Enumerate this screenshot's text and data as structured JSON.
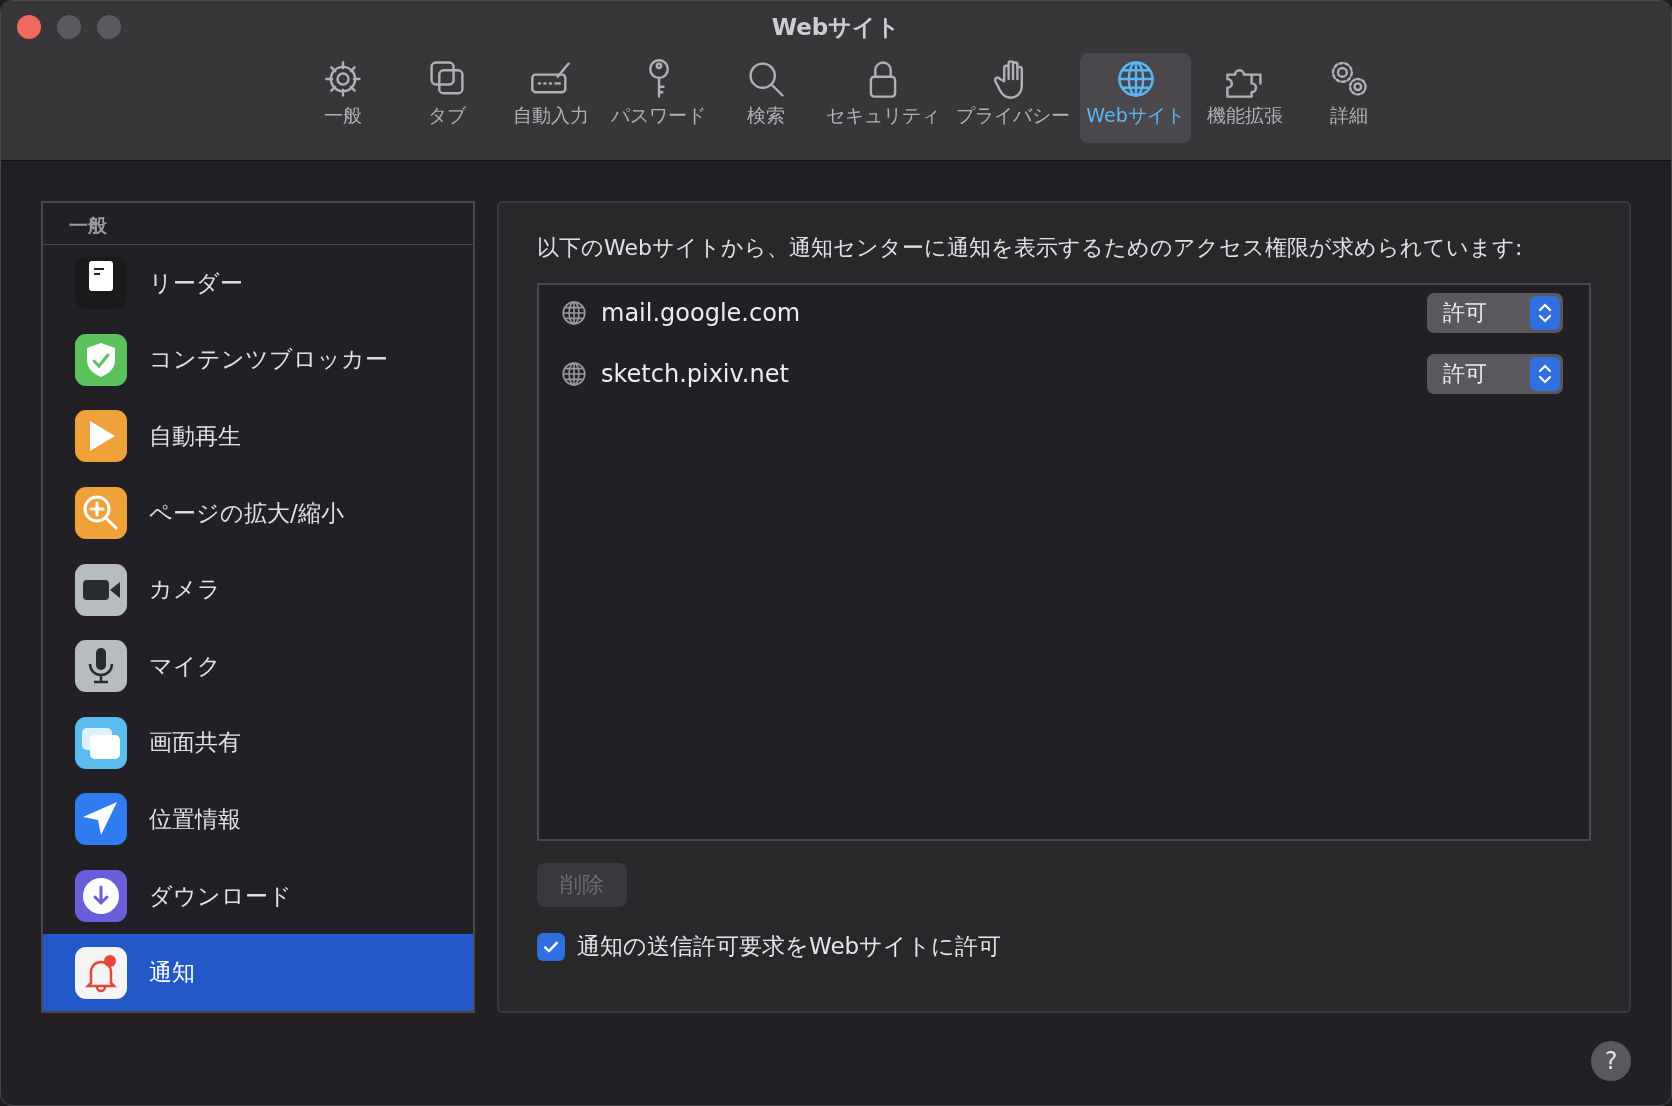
{
  "window": {
    "title": "Webサイト"
  },
  "toolbar": {
    "tabs": [
      {
        "label": "一般",
        "selected": false
      },
      {
        "label": "タブ",
        "selected": false
      },
      {
        "label": "自動入力",
        "selected": false
      },
      {
        "label": "パスワード",
        "selected": false
      },
      {
        "label": "検索",
        "selected": false
      },
      {
        "label": "セキュリティ",
        "selected": false
      },
      {
        "label": "プライバシー",
        "selected": false
      },
      {
        "label": "Webサイト",
        "selected": true
      },
      {
        "label": "機能拡張",
        "selected": false
      },
      {
        "label": "詳細",
        "selected": false
      }
    ]
  },
  "sidebar": {
    "header": "一般",
    "items": [
      {
        "label": "リーダー",
        "selected": false
      },
      {
        "label": "コンテンツブロッカー",
        "selected": false
      },
      {
        "label": "自動再生",
        "selected": false
      },
      {
        "label": "ページの拡大/縮小",
        "selected": false
      },
      {
        "label": "カメラ",
        "selected": false
      },
      {
        "label": "マイク",
        "selected": false
      },
      {
        "label": "画面共有",
        "selected": false
      },
      {
        "label": "位置情報",
        "selected": false
      },
      {
        "label": "ダウンロード",
        "selected": false
      },
      {
        "label": "通知",
        "selected": true
      }
    ]
  },
  "panel": {
    "description": "以下のWebサイトから、通知センターに通知を表示するためのアクセス権限が求められています:",
    "websites": [
      {
        "domain": "mail.google.com",
        "permission": "許可"
      },
      {
        "domain": "sketch.pixiv.net",
        "permission": "許可"
      }
    ],
    "delete_button": {
      "label": "削除",
      "disabled": true
    },
    "checkbox": {
      "label": "通知の送信許可要求をWebサイトに許可",
      "checked": true
    }
  },
  "help_button": {
    "label": "?"
  }
}
